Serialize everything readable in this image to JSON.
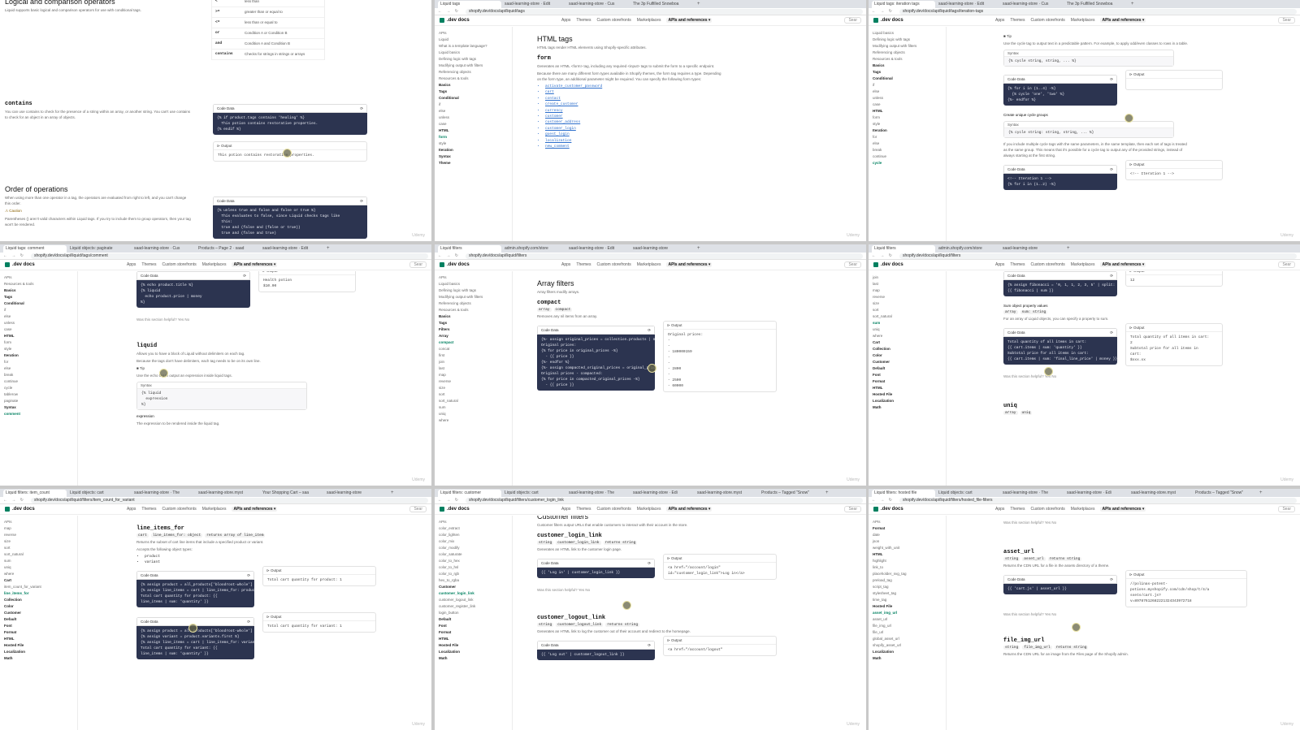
{
  "site": {
    "logo": ".dev docs",
    "nav": [
      "Apps",
      "Themes",
      "Custom storefronts",
      "Marketplaces"
    ],
    "nav_active": "APIs and references",
    "search": "Sear"
  },
  "tiles": {
    "t1": {
      "section_title": "Logical and comparison operators",
      "intro": "Liquid supports basic logical and comparison operators for use with conditional tags.",
      "operators": [
        {
          "op": "<",
          "desc": "less than"
        },
        {
          "op": ">=",
          "desc": "greater than or equal to"
        },
        {
          "op": "<=",
          "desc": "less than or equal to"
        },
        {
          "op": "or",
          "desc": "Condition A or Condition B"
        },
        {
          "op": "and",
          "desc": "Condition A and Condition B"
        },
        {
          "op": "contains",
          "desc": "Checks for strings in strings or arrays"
        }
      ],
      "contains_title": "contains",
      "contains_text": "You can use contains to check for the presence of a string within an array, or another string. You can't use contains to check for an object in an array of objects.",
      "code1": [
        "{% if product.tags contains 'healing' %}",
        "  This potion contains restorative properties.",
        "{% endif %}"
      ],
      "output_label": "Output",
      "output1": "This potion contains restorative properties.",
      "order_title": "Order of operations",
      "order_text": "When using more than one operator in a tag, the operators are evaluated from right to left, and you can't change this order.",
      "caution": "Caution",
      "caution_text": "Parentheses () aren't valid characters within Liquid tags. If you try to include them to group operators, then your tag won't be rendered.",
      "code2": [
        "{% unless true and false and false or true %}",
        "  This evaluates to false, since Liquid checks tags like",
        "  this:",
        "",
        "  true and (false and (false or true))",
        "  true and (false and true)"
      ]
    },
    "t2": {
      "tabs": [
        "Liquid tags",
        "saad-learning-store · Edit",
        "saad-learning-store · Cus",
        "The 3p Fulfilled Snowboa"
      ],
      "url": "shopify.dev/docs/api/liquid/tags",
      "sidebar": [
        "APIs",
        "Liquid",
        "What is a template language?",
        "Liquid basics",
        "Defining logic with tags",
        "Modifying output with filters",
        "Referencing objects",
        "Resources & tools",
        "Basics",
        "Tags",
        "Conditional",
        "if",
        "else",
        "unless",
        "case",
        "HTML",
        "form",
        "style",
        "Iteration",
        "Syntax",
        "Theme"
      ],
      "page_title": "HTML tags",
      "page_sub": "HTML tags render HTML elements using Shopify-specific attributes.",
      "form_title": "form",
      "form_text": "Generates an HTML <form> tag, including any required <input> tags to submit the form to a specific endpoint.",
      "form_text2": "Because there are many different form types available in Shopify themes, the form tag requires a type. Depending on the form type, an additional parameter might be required. You can specify the following form types:",
      "types": [
        "activate_customer_password",
        "cart",
        "contact",
        "create_customer",
        "currency",
        "customer",
        "customer_address",
        "customer_login",
        "guest_login",
        "localization",
        "new_comment"
      ]
    },
    "t3": {
      "tabs": [
        "Liquid tags: iteration tags",
        "saad-learning-store · Edit",
        "saad-learning-store · Cus",
        "The 3p Fulfilled Snowboa"
      ],
      "url": "shopify.dev/docs/api/liquid/tags/iteration-tags",
      "sidebar": [
        "Liquid basics",
        "Defining logic with tags",
        "Modifying output with filters",
        "Referencing objects",
        "Resources & tools",
        "Basics",
        "Tags",
        "Conditional",
        "if",
        "else",
        "unless",
        "case",
        "HTML",
        "form",
        "style",
        "Iteration",
        "for",
        "else",
        "break",
        "continue",
        "cycle"
      ],
      "tip": "Tip",
      "tip_text": "Use the cycle tag to output text in a predictable pattern. For example, to apply odd/even classes to rows in a table.",
      "syntax_label": "Syntax",
      "syntax1": "{% cycle string, string, ... %}",
      "code": [
        "{% for i in (1..4) -%}",
        "  {% cycle 'one', 'two' %}",
        "{%- endfor %}"
      ],
      "groups_title": "Create unique cycle groups",
      "syntax2": "{% cycle string: string, string, ... %}",
      "groups_text": "If you include multiple cycle tags with the same parameters, in the same template, then each set of tags is treated as the same group. This means that it's possible for a cycle tag to output any of the provided strings, instead of always starting at the first string.",
      "code2": [
        "<!-- Iteration 1 -->",
        "{% for i in (1..2) -%}"
      ],
      "output2": [
        "<!-- Iteration 1 -->"
      ]
    },
    "t4": {
      "tabs": [
        "Liquid tags: comment",
        "Liquid objects: paginate",
        "saad-learning-store · Cus",
        "Products – Page 2 · saad",
        "saad-learning-store · Edit"
      ],
      "url": "shopify.dev/docs/api/liquid/tags/comment",
      "sidebar": [
        "APIs",
        "Resources & tools",
        "Basics",
        "Tags",
        "Conditional",
        "if",
        "else",
        "unless",
        "case",
        "HTML",
        "form",
        "style",
        "Iteration",
        "for",
        "else",
        "break",
        "continue",
        "cycle",
        "tablerow",
        "paginate",
        "Syntax",
        "comment"
      ],
      "code": [
        "{% echo product.title %}",
        "",
        "{% liquid",
        "  echo product.price | money",
        "%}"
      ],
      "output": [
        "Health potion",
        "",
        "$10.00"
      ],
      "helpful": "Was this section helpful?",
      "yes": "Yes",
      "no": "No",
      "liquid_title": "liquid",
      "liquid_text": "Allows you to have a block of Liquid without delimiters on each tag.",
      "liquid_text2": "Because the tags don't have delimiters, each tag needs to be on its own line.",
      "tip": "Tip",
      "tip_text": "Use the echo tag to output an expression inside liquid tags.",
      "syntax_label": "Syntax",
      "syntax": [
        "{% liquid",
        "  expression",
        "%}"
      ],
      "expr_label": "expression",
      "expr_text": "The expression to be rendered inside the liquid tag."
    },
    "t5": {
      "tabs": [
        "Liquid filters",
        "admin.shopify.com/store",
        "saad-learning-store · Edit",
        "saad-learning-store"
      ],
      "url": "shopify.dev/docs/api/liquid/filters",
      "sidebar": [
        "APIs",
        "Liquid basics",
        "Defining logic with tags",
        "Modifying output with filters",
        "Referencing objects",
        "Resources & tools",
        "Basics",
        "Tags",
        "Filters",
        "Array",
        "compact",
        "concat",
        "first",
        "join",
        "last",
        "map",
        "reverse",
        "size",
        "sort",
        "sort_natural",
        "sum",
        "uniq",
        "where"
      ],
      "section_title": "Array filters",
      "section_sub": "Array filters modify arrays.",
      "filter_title": "compact",
      "chips": [
        "array",
        "compact"
      ],
      "filter_text": "Removes any nil items from an array.",
      "code": [
        "{%- assign original_prices = collection.products | map: 'compare_at_price' -%}",
        "",
        "Original prices:",
        "",
        "{% for price in original_prices -%}",
        "  - {{ price }}",
        "{%- endfor %}",
        "",
        "{%- assign compacted_original_prices = original_prices | compact -%}",
        "",
        "Original prices - compacted:",
        "",
        "{% for price in compacted_original_prices -%}",
        "  - {{ price }}"
      ],
      "output": [
        "Original prices:",
        "",
        "-",
        "-",
        "- 180000159",
        "-",
        "-",
        "- 2800",
        "-",
        "- 2500",
        "- 60000"
      ]
    },
    "t6": {
      "tabs": [
        "Liquid filters",
        "admin.shopify.com/store",
        "saad-learning-store"
      ],
      "url": "shopify.dev/docs/api/liquid/filters",
      "sidebar": [
        "join",
        "last",
        "map",
        "reverse",
        "size",
        "sort",
        "sort_natural",
        "sum",
        "uniq",
        "where",
        "Cart",
        "Collection",
        "Color",
        "Customer",
        "Default",
        "Font",
        "Format",
        "HTML",
        "Hosted File",
        "Localization",
        "Math"
      ],
      "code": [
        "{% assign fibonacci = '0, 1, 1, 2, 3, 5' | split: ', ' %}",
        "",
        "{{ fibonacci | sum }}"
      ],
      "output": [
        "12"
      ],
      "sum_title": "Sum object property values",
      "chips": [
        "array",
        "sum: string"
      ],
      "sum_text": "For an array of Liquid objects, you can specify a property to sum.",
      "code2": [
        "Total quantity of all items in cart:",
        "{{ cart.items | sum: 'quantity' }}",
        "",
        "Subtotal price for all items in cart:",
        "{{ cart.items | sum: 'final_line_price' | money }}"
      ],
      "output2": [
        "Total quantity of all items in cart:",
        "2",
        "",
        "Subtotal price for all items in",
        "cart:",
        "$xxx.xx"
      ],
      "helpful": "Was this section helpful?",
      "yes": "Yes",
      "no": "No",
      "uniq_title": "uniq",
      "uniq_chips": [
        "array",
        "uniq"
      ]
    },
    "t7": {
      "tabs": [
        "Liquid filters: item_count",
        "Liquid objects: cart",
        "saad-learning-store · The",
        "saad-learning-store.myst",
        "Your Shopping Cart – saa",
        "saad-learning-store"
      ],
      "url": "shopify.dev/docs/api/liquid/filters/item_count_for_variant",
      "sidebar": [
        "APIs",
        "map",
        "reverse",
        "size",
        "sort",
        "sort_natural",
        "sum",
        "uniq",
        "where",
        "Cart",
        "item_count_for_variant",
        "line_items_for",
        "Collection",
        "Color",
        "Customer",
        "Default",
        "Font",
        "Format",
        "HTML",
        "Hosted File",
        "Localization",
        "Math"
      ],
      "title": "line_items_for",
      "chips": [
        "cart",
        "line_items_for: object",
        "returns array of line_item"
      ],
      "text": "Returns the subset of cart line items that include a specified product or variant.",
      "text2": "Accepts the following object types:",
      "types": [
        "product",
        "variant"
      ],
      "code1": [
        "{% assign product = all_products['bloodroot-whole'] %}",
        "{% assign line_items = cart | line_items_for: product %}",
        "",
        "Total cart quantity for product: {{",
        "line_items | sum: 'quantity' }}"
      ],
      "out1": [
        "Total cart quantity for product: 1"
      ],
      "code2": [
        "{% assign product = all_products['bloodroot-whole'] %}",
        "{% assign variant = product.variants.first %}",
        "{% assign line_items = cart | line_items_for: variant %}",
        "",
        "Total cart quantity for variant: {{",
        "line_items | sum: 'quantity' }}"
      ],
      "out2": [
        "Total cart quantity for variant: 1"
      ]
    },
    "t8": {
      "tabs": [
        "Liquid filters: customer",
        "Liquid objects: cart",
        "saad-learning-store · The",
        "saad-learning-store · Edi",
        "saad-learning-store.myst",
        "Products – Tagged \"Snow\""
      ],
      "url": "shopify.dev/docs/api/liquid/filters/customer_login_link",
      "sidebar": [
        "APIs",
        "color_extract",
        "color_lighten",
        "color_mix",
        "color_modify",
        "color_saturate",
        "color_to_hex",
        "color_to_hsl",
        "color_to_rgb",
        "hex_to_rgba",
        "Customer",
        "customer_login_link",
        "customer_logout_link",
        "customer_register_link",
        "login_button",
        "Default",
        "Font",
        "Format",
        "HTML",
        "Hosted File",
        "Localization",
        "Math"
      ],
      "section_title": "Customer filters",
      "section_sub": "Customer filters output URLs that enable customers to interact with their account in the store.",
      "f1_title": "customer_login_link",
      "f1_chips": [
        "string",
        "customer_login_link",
        "returns string"
      ],
      "f1_text": "Generates an HTML link to the customer login page.",
      "code1": [
        "{{ 'Log in' | customer_login_link }}"
      ],
      "out1": [
        "<a href=\"/account/login\"",
        "id=\"customer_login_link\">Log in</a>"
      ],
      "helpful": "Was this section helpful?",
      "yes": "Yes",
      "no": "No",
      "f2_title": "customer_logout_link",
      "f2_chips": [
        "string",
        "customer_logout_link",
        "returns string"
      ],
      "f2_text": "Generates an HTML link to log the customer out of their account and redirect to the homepage.",
      "code2": [
        "{{ 'Log out' | customer_logout_link }}"
      ],
      "out2": [
        "<a href=\"/account/logout\""
      ]
    },
    "t9": {
      "tabs": [
        "Liquid filters: hosted file",
        "Liquid objects: cart",
        "saad-learning-store · The",
        "saad-learning-store · Edi",
        "saad-learning-store.myst",
        "Products – Tagged \"Snow\""
      ],
      "url": "shopify.dev/docs/api/liquid/filters/hosted_file-filters",
      "sidebar": [
        "APIs",
        "Format",
        "date",
        "json",
        "weight_with_unit",
        "HTML",
        "highlight",
        "link_to",
        "placeholder_svg_tag",
        "preload_tag",
        "script_tag",
        "stylesheet_tag",
        "time_tag",
        "Hosted File",
        "asset_img_url",
        "asset_url",
        "file_img_url",
        "file_url",
        "global_asset_url",
        "shopify_asset_url",
        "Localization",
        "Math"
      ],
      "helpful": "Was this section helpful?",
      "yes": "Yes",
      "no": "No",
      "f1_title": "asset_url",
      "f1_chips": [
        "string",
        "asset_url",
        "returns string"
      ],
      "f1_text": "Returns the CDN URL for a file in the assets directory of a theme.",
      "code1": [
        "{{ 'cart.js' | asset_url }}"
      ],
      "out1": [
        "//polinas-potent-",
        "potions.myshopify.com/cdn/shop/t/4/a",
        "ssets/cart.js?",
        "v=89787612682221324343972718"
      ],
      "f2_title": "file_img_url",
      "f2_chips": [
        "string",
        "file_img_url",
        "returns string"
      ],
      "f2_text": "Returns the CDN URL for an image from the Files page of the Shopify admin."
    },
    "labels": {
      "code": "Code",
      "data": "Data",
      "output": "Output",
      "back": "APIs",
      "new_tab": "+",
      "nav_icons": "← → ↻",
      "watermark": "Udemy"
    }
  }
}
